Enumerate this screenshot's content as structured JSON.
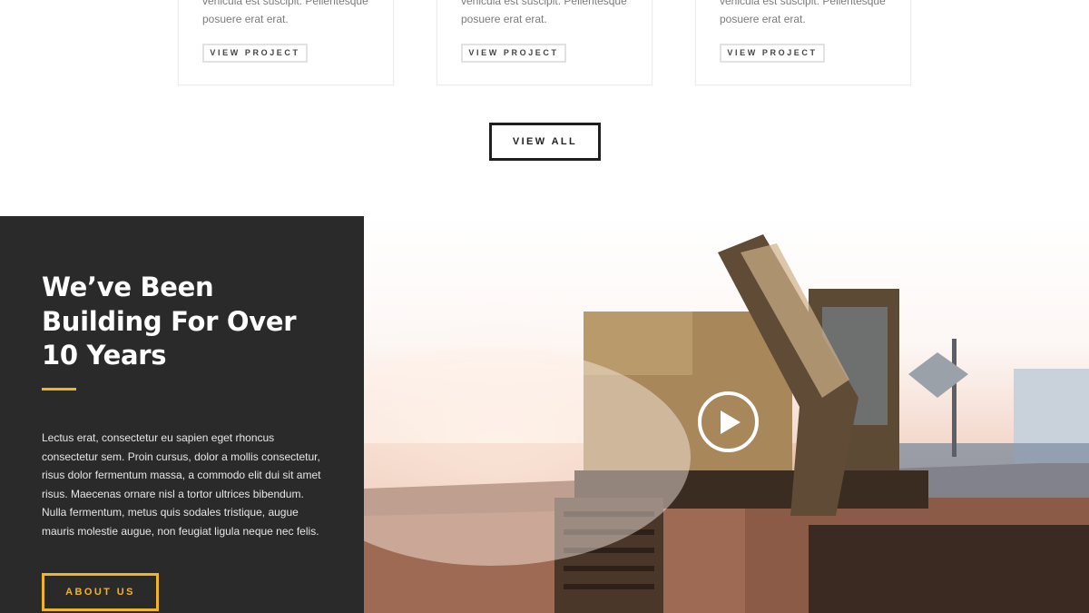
{
  "projects": {
    "cards": [
      {
        "text_line1": "vehicula est suscipit. Pellentesque",
        "text_line2": "posuere erat erat.",
        "button_label": "VIEW PROJECT"
      },
      {
        "text_line1": "vehicula est suscipit. Pellentesque",
        "text_line2": "posuere erat erat.",
        "button_label": "VIEW PROJECT"
      },
      {
        "text_line1": "vehicula est suscipit. Pellentesque",
        "text_line2": "posuere erat erat.",
        "button_label": "VIEW PROJECT"
      }
    ],
    "view_all_label": "VIEW ALL"
  },
  "about": {
    "title_lines": [
      "We’ve Been",
      "Building For Over",
      "10 Years"
    ],
    "body_lines": [
      "Lectus erat, consectetur eu sapien eget rhoncus",
      "consectetur sem. Proin cursus, dolor a mollis consectetur,",
      "risus dolor fermentum massa, a commodo elit dui sit amet",
      "risus. Maecenas ornare nisl a tortor ultrices bibendum.",
      "Nulla fermentum, metus quis sodales tristique, augue",
      "mauris molestie augue, non feugiat ligula neque nec felis."
    ],
    "button_label": "ABOUT US"
  },
  "video": {
    "image_subject": "excavator-at-sunset",
    "play_icon": "play-icon"
  },
  "colors": {
    "accent": "#f0b429",
    "dark_panel": "#2a2a2b",
    "button_border": "#1f1f1f"
  }
}
